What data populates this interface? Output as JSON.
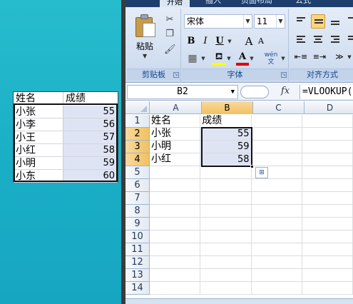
{
  "desktop": {
    "table": {
      "headers": [
        "姓名",
        "成绩"
      ],
      "rows": [
        {
          "name": "小张",
          "score": "55"
        },
        {
          "name": "小李",
          "score": "56"
        },
        {
          "name": "小王",
          "score": "57"
        },
        {
          "name": "小红",
          "score": "58"
        },
        {
          "name": "小明",
          "score": "59"
        },
        {
          "name": "小东",
          "score": "60"
        }
      ]
    }
  },
  "excel": {
    "tabs": [
      "开始",
      "插入",
      "页面布局",
      "公式"
    ],
    "ribbon": {
      "clipboard": {
        "paste_label": "粘贴",
        "group_label": "剪贴板"
      },
      "font": {
        "font_name": "宋体",
        "font_size": "11",
        "bold": "B",
        "italic": "I",
        "underline": "U",
        "grow": "A",
        "shrink": "A",
        "font_color": "A",
        "phonetic": "wén 文",
        "group_label": "字体"
      },
      "alignment": {
        "group_label": "对齐方式"
      }
    },
    "formula_bar": {
      "name_box": "B2",
      "fx": "fx",
      "formula": "=VLOOKUP("
    },
    "columns": [
      "A",
      "B",
      "C",
      "D"
    ],
    "selected_column": "B",
    "rows": [
      {
        "num": "1",
        "a": "姓名",
        "b": "成绩"
      },
      {
        "num": "2",
        "a": "小张",
        "b": "55"
      },
      {
        "num": "3",
        "a": "小明",
        "b": "59"
      },
      {
        "num": "4",
        "a": "小红",
        "b": "58"
      },
      {
        "num": "5",
        "a": "",
        "b": ""
      },
      {
        "num": "6",
        "a": "",
        "b": ""
      },
      {
        "num": "7",
        "a": "",
        "b": ""
      },
      {
        "num": "8",
        "a": "",
        "b": ""
      },
      {
        "num": "9",
        "a": "",
        "b": ""
      },
      {
        "num": "10",
        "a": "",
        "b": ""
      },
      {
        "num": "11",
        "a": "",
        "b": ""
      },
      {
        "num": "12",
        "a": "",
        "b": ""
      },
      {
        "num": "13",
        "a": "",
        "b": ""
      },
      {
        "num": "14",
        "a": "",
        "b": ""
      }
    ],
    "selected_rows": [
      "2",
      "3",
      "4"
    ],
    "colors": {
      "selection_fill": "#dfe4f4",
      "header_highlight": "#f1c15f",
      "ribbon_bg": "#d5e1f2",
      "desktop_bg": "#1fb3c8"
    }
  }
}
